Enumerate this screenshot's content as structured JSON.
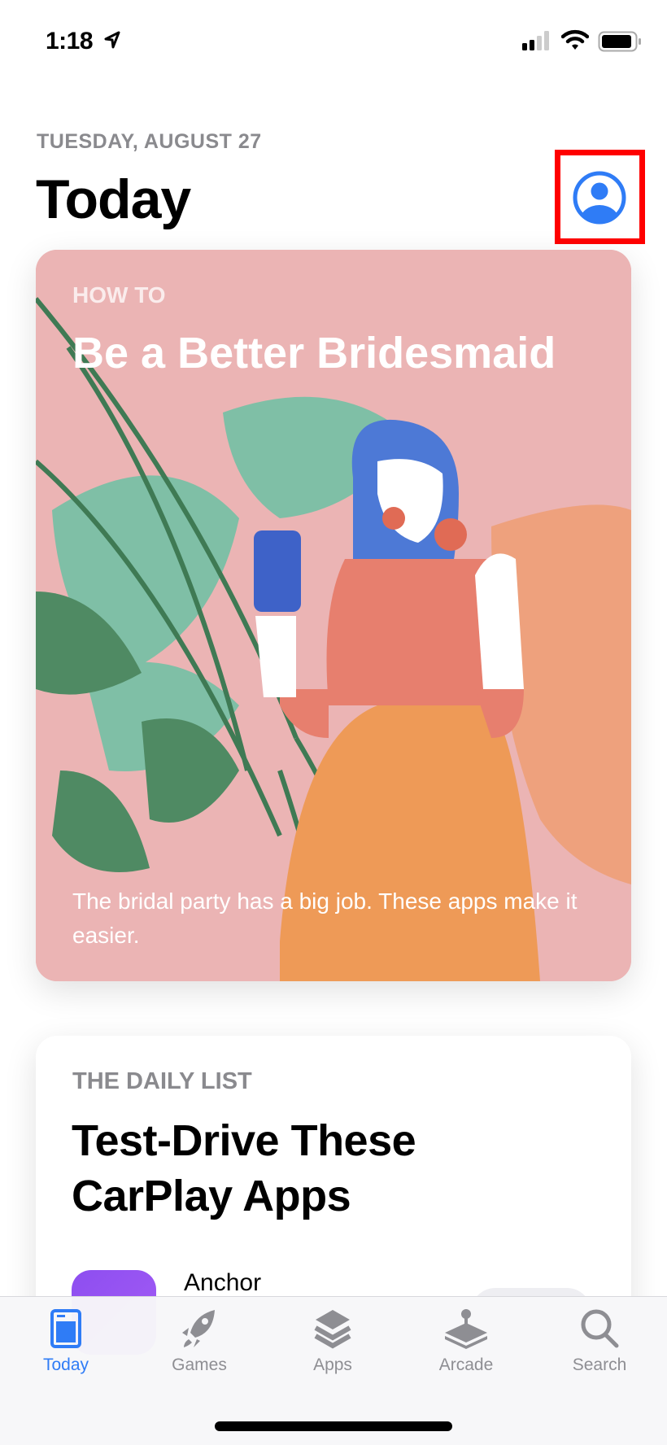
{
  "status_bar": {
    "time": "1:18",
    "icons": [
      "location-arrow-icon",
      "cellular-signal-icon",
      "wifi-icon",
      "battery-icon"
    ]
  },
  "header": {
    "date": "TUESDAY, AUGUST 27",
    "title": "Today",
    "profile_icon": "person-circle-icon",
    "accent": "#2f7cf6"
  },
  "cards": [
    {
      "kicker": "HOW TO",
      "title": "Be a Better Bridesmaid",
      "description": "The bridal party has a big job. These apps make it easier.",
      "background": "#ebb4b4"
    },
    {
      "kicker": "THE DAILY LIST",
      "title": "Test-Drive These CarPlay Apps",
      "apps": [
        {
          "name": "Anchor"
        }
      ]
    }
  ],
  "tab_bar": {
    "items": [
      {
        "label": "Today",
        "icon": "today-icon",
        "active": true
      },
      {
        "label": "Games",
        "icon": "rocket-icon",
        "active": false
      },
      {
        "label": "Apps",
        "icon": "layers-icon",
        "active": false
      },
      {
        "label": "Arcade",
        "icon": "joystick-icon",
        "active": false
      },
      {
        "label": "Search",
        "icon": "search-icon",
        "active": false
      }
    ]
  }
}
